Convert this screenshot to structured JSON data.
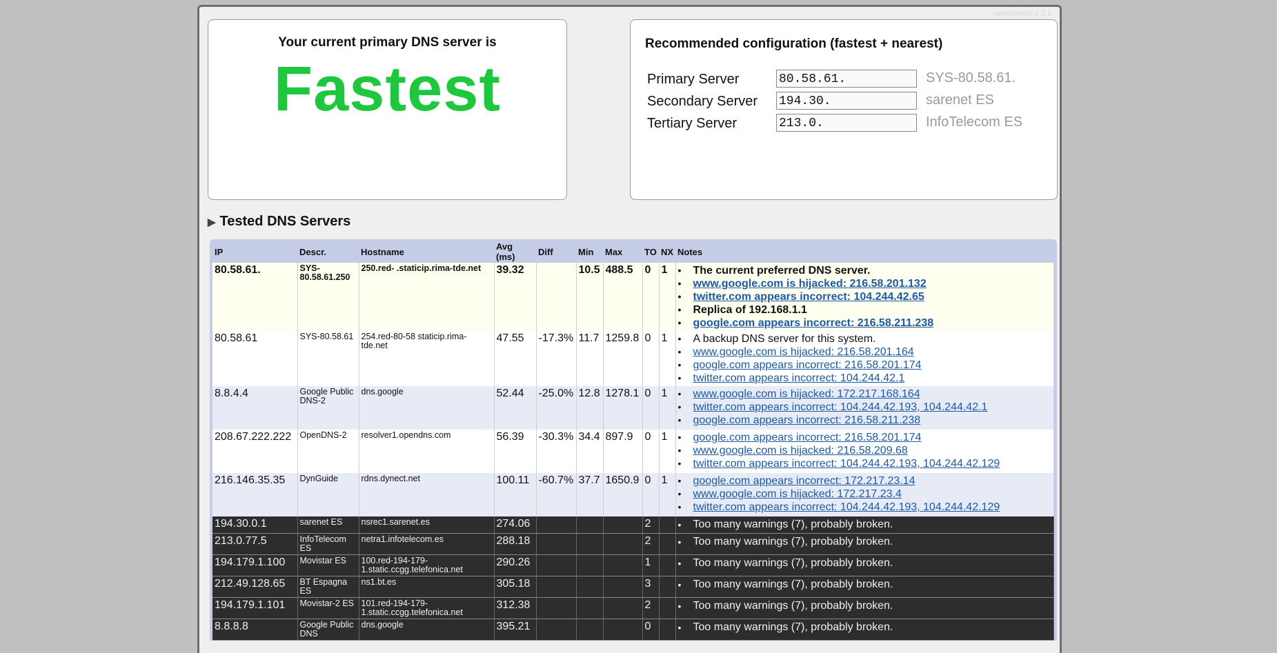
{
  "app": {
    "version": "namebench 1.3.1"
  },
  "current": {
    "title": "Your current primary DNS server is",
    "verdict": "Fastest",
    "verdict_color": "#1ec83c"
  },
  "recommended": {
    "title": "Recommended configuration (fastest + nearest)",
    "rows": [
      {
        "label": "Primary Server",
        "value": "80.58.61.",
        "desc": "SYS-80.58.61."
      },
      {
        "label": "Secondary Server",
        "value": "194.30.",
        "desc": "sarenet ES"
      },
      {
        "label": "Tertiary Server",
        "value": "213.0.",
        "desc": "InfoTelecom ES"
      }
    ]
  },
  "tested": {
    "title": "Tested DNS Servers",
    "headers": [
      "IP",
      "Descr.",
      "Hostname",
      "Avg (ms)",
      "Diff",
      "Min",
      "Max",
      "TO",
      "NX",
      "Notes"
    ],
    "rows": [
      {
        "ip": "80.58.61.",
        "descr": "SYS-80.58.61.250",
        "host": "250.red-              .staticip.rima-tde.net",
        "avg": "39.32",
        "diff": "",
        "min": "10.5",
        "max": "488.5",
        "to": "0",
        "nx": "1",
        "notes": [
          {
            "text": "The current preferred DNS server.",
            "link": false
          },
          {
            "text": "www.google.com is hijacked: 216.58.201.132",
            "link": true
          },
          {
            "text": "twitter.com appears incorrect: 104.244.42.65",
            "link": true
          },
          {
            "text": "Replica of 192.168.1.1",
            "link": false
          },
          {
            "text": "google.com appears incorrect: 216.58.211.238",
            "link": true
          }
        ]
      },
      {
        "ip": "80.58.61",
        "descr": "SYS-80.58.61",
        "host": "254.red-80-58          staticip.rima-tde.net",
        "avg": "47.55",
        "diff": "-17.3%",
        "min": "11.7",
        "max": "1259.8",
        "to": "0",
        "nx": "1",
        "notes": [
          {
            "text": "A backup DNS server for this system.",
            "link": false
          },
          {
            "text": "www.google.com is hijacked: 216.58.201.164",
            "link": true
          },
          {
            "text": "google.com appears incorrect: 216.58.201.174",
            "link": true
          },
          {
            "text": "twitter.com appears incorrect: 104.244.42.1",
            "link": true
          }
        ]
      },
      {
        "ip": "8.8.4.4",
        "descr": "Google Public DNS-2",
        "host": "dns.google",
        "avg": "52.44",
        "diff": "-25.0%",
        "min": "12.8",
        "max": "1278.1",
        "to": "0",
        "nx": "1",
        "notes": [
          {
            "text": "www.google.com is hijacked: 172.217.168.164",
            "link": true
          },
          {
            "text": "twitter.com appears incorrect: 104.244.42.193, 104.244.42.1",
            "link": true
          },
          {
            "text": "google.com appears incorrect: 216.58.211.238",
            "link": true
          }
        ]
      },
      {
        "ip": "208.67.222.222",
        "descr": "OpenDNS-2",
        "host": "resolver1.opendns.com",
        "avg": "56.39",
        "diff": "-30.3%",
        "min": "34.4",
        "max": "897.9",
        "to": "0",
        "nx": "1",
        "notes": [
          {
            "text": "google.com appears incorrect: 216.58.201.174",
            "link": true
          },
          {
            "text": "www.google.com is hijacked: 216.58.209.68",
            "link": true
          },
          {
            "text": "twitter.com appears incorrect: 104.244.42.193, 104.244.42.129",
            "link": true
          }
        ]
      },
      {
        "ip": "216.146.35.35",
        "descr": "DynGuide",
        "host": "rdns.dynect.net",
        "avg": "100.11",
        "diff": "-60.7%",
        "min": "37.7",
        "max": "1650.9",
        "to": "0",
        "nx": "1",
        "notes": [
          {
            "text": "google.com appears incorrect: 172.217.23.14",
            "link": true
          },
          {
            "text": "www.google.com is hijacked: 172.217.23.4",
            "link": true
          },
          {
            "text": "twitter.com appears incorrect: 104.244.42.193, 104.244.42.129",
            "link": true
          }
        ]
      },
      {
        "ip": "194.30.0.1",
        "descr": "sarenet ES",
        "host": "nsrec1.sarenet.es",
        "avg": "274.06",
        "diff": "",
        "min": "",
        "max": "",
        "to": "2",
        "nx": "",
        "notes": [
          {
            "text": "Too many warnings (7), probably broken.",
            "link": false
          }
        ]
      },
      {
        "ip": "213.0.77.5",
        "descr": "InfoTelecom ES",
        "host": "netra1.infotelecom.es",
        "avg": "288.18",
        "diff": "",
        "min": "",
        "max": "",
        "to": "2",
        "nx": "",
        "notes": [
          {
            "text": "Too many warnings (7), probably broken.",
            "link": false
          }
        ]
      },
      {
        "ip": "194.179.1.100",
        "descr": "Movistar ES",
        "host": "100.red-194-179-1.static.ccgg.telefonica.net",
        "avg": "290.26",
        "diff": "",
        "min": "",
        "max": "",
        "to": "1",
        "nx": "",
        "notes": [
          {
            "text": "Too many warnings (7), probably broken.",
            "link": false
          }
        ]
      },
      {
        "ip": "212.49.128.65",
        "descr": "BT Espagna ES",
        "host": "ns1.bt.es",
        "avg": "305.18",
        "diff": "",
        "min": "",
        "max": "",
        "to": "3",
        "nx": "",
        "notes": [
          {
            "text": "Too many warnings (7), probably broken.",
            "link": false
          }
        ]
      },
      {
        "ip": "194.179.1.101",
        "descr": "Movistar-2 ES",
        "host": "101.red-194-179-1.static.ccgg.telefonica.net",
        "avg": "312.38",
        "diff": "",
        "min": "",
        "max": "",
        "to": "2",
        "nx": "",
        "notes": [
          {
            "text": "Too many warnings (7), probably broken.",
            "link": false
          }
        ]
      },
      {
        "ip": "8.8.8.8",
        "descr": "Google Public DNS",
        "host": "dns.google",
        "avg": "395.21",
        "diff": "",
        "min": "",
        "max": "",
        "to": "0",
        "nx": "",
        "notes": [
          {
            "text": "Too many warnings (7), probably broken.",
            "link": false
          }
        ]
      }
    ]
  }
}
